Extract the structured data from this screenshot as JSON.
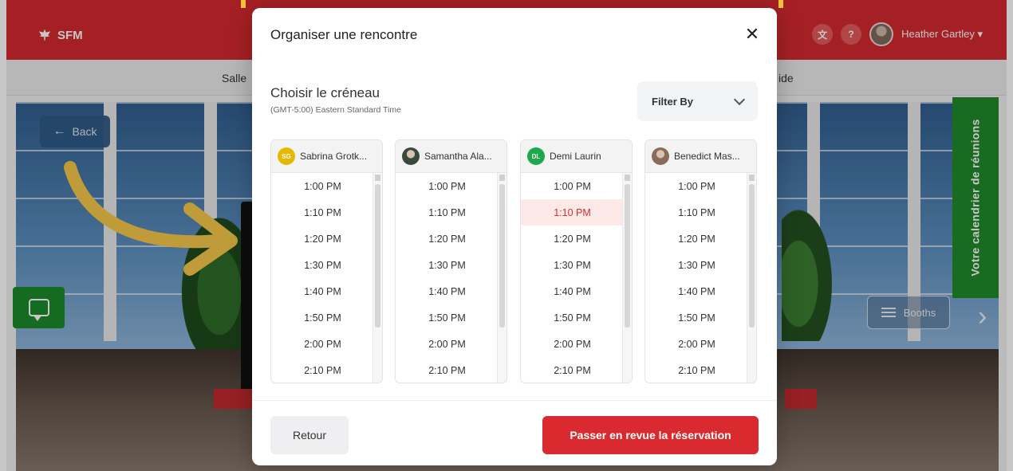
{
  "app": {
    "brand": "SFM",
    "user_name": "Heather Gartley",
    "help_label": "?",
    "nav_left": "Salle",
    "nav_right": "ide",
    "back_label": "Back",
    "calendar_tab": "Votre calendrier de réunions",
    "booths_label": "Booths"
  },
  "modal": {
    "title": "Organiser une rencontre",
    "section_title": "Choisir le créneau",
    "timezone": "(GMT-5:00) Eastern Standard Time",
    "filter_label": "Filter By",
    "columns": [
      {
        "initials": "SG",
        "badge_color": "#e6b800",
        "name": "Sabrina Grotk...",
        "selected": null,
        "slots": [
          "1:00 PM",
          "1:10 PM",
          "1:20 PM",
          "1:30 PM",
          "1:40 PM",
          "1:50 PM",
          "2:00 PM",
          "2:10 PM"
        ]
      },
      {
        "initials": "",
        "badge_color": "#3a4a3a",
        "name": "Samantha Ala...",
        "selected": null,
        "slots": [
          "1:00 PM",
          "1:10 PM",
          "1:20 PM",
          "1:30 PM",
          "1:40 PM",
          "1:50 PM",
          "2:00 PM",
          "2:10 PM"
        ]
      },
      {
        "initials": "DL",
        "badge_color": "#1ea84a",
        "name": "Demi Laurin",
        "selected": 1,
        "slots": [
          "1:00 PM",
          "1:10 PM",
          "1:20 PM",
          "1:30 PM",
          "1:40 PM",
          "1:50 PM",
          "2:00 PM",
          "2:10 PM"
        ]
      },
      {
        "initials": "",
        "badge_color": "#8a6a58",
        "name": "Benedict Mas...",
        "selected": null,
        "slots": [
          "1:00 PM",
          "1:10 PM",
          "1:20 PM",
          "1:30 PM",
          "1:40 PM",
          "1:50 PM",
          "2:00 PM",
          "2:10 PM"
        ]
      }
    ],
    "back_button": "Retour",
    "review_button": "Passer en revue la réservation"
  },
  "colors": {
    "brand_red": "#d42a2f",
    "accent_green": "#1f8a2a",
    "selected_text": "#d32f2f",
    "selected_bg": "#fce9e8"
  }
}
